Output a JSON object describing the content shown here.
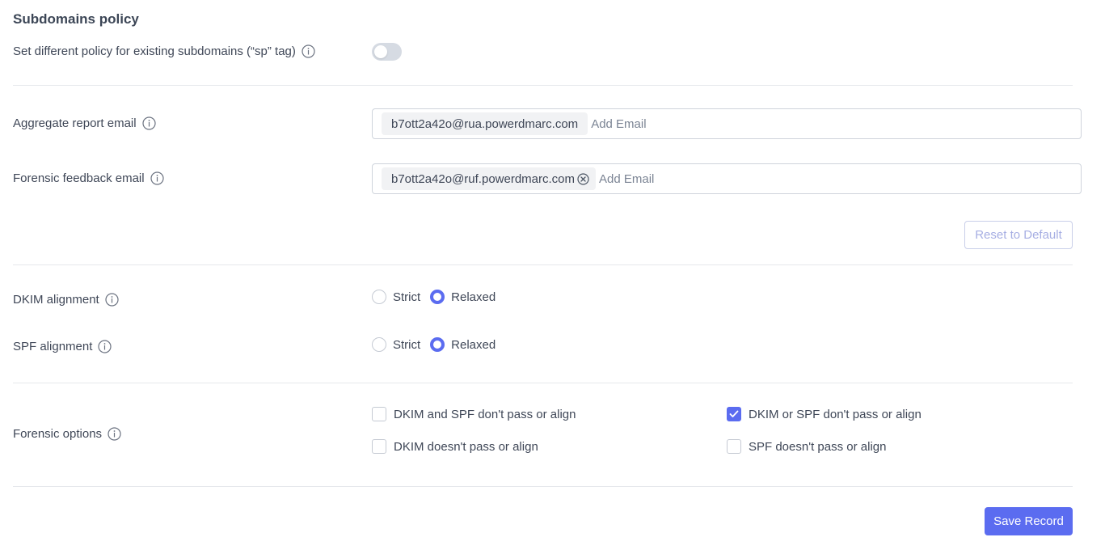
{
  "subdomains": {
    "title": "Subdomains policy",
    "sp_label": "Set different policy for existing subdomains (“sp” tag)",
    "sp_toggle_on": false
  },
  "aggregate": {
    "label": "Aggregate report email",
    "chip": "b7ott2a42o@rua.powerdmarc.com",
    "placeholder": "Add Email"
  },
  "forensic_email": {
    "label": "Forensic feedback email",
    "chip": "b7ott2a42o@ruf.powerdmarc.com",
    "placeholder": "Add Email"
  },
  "reset_label": "Reset to Default",
  "dkim_alignment": {
    "label": "DKIM alignment",
    "options": [
      "Strict",
      "Relaxed"
    ],
    "selected": "Relaxed"
  },
  "spf_alignment": {
    "label": "SPF alignment",
    "options": [
      "Strict",
      "Relaxed"
    ],
    "selected": "Relaxed"
  },
  "forensic_options": {
    "label": "Forensic options",
    "items": [
      {
        "label": "DKIM and SPF don't pass or align",
        "checked": false
      },
      {
        "label": "DKIM or SPF don't pass or align",
        "checked": true
      },
      {
        "label": "DKIM doesn't pass or align",
        "checked": false
      },
      {
        "label": "SPF doesn't pass or align",
        "checked": false
      }
    ]
  },
  "save_label": "Save Record",
  "colors": {
    "accent": "#5b6cf0",
    "text": "#3f4757",
    "border": "#cfd4dc",
    "divider": "#e6e8ec"
  },
  "icons": {
    "info": "info-icon",
    "chip_close": "close-circle-icon",
    "check": "check-icon"
  }
}
